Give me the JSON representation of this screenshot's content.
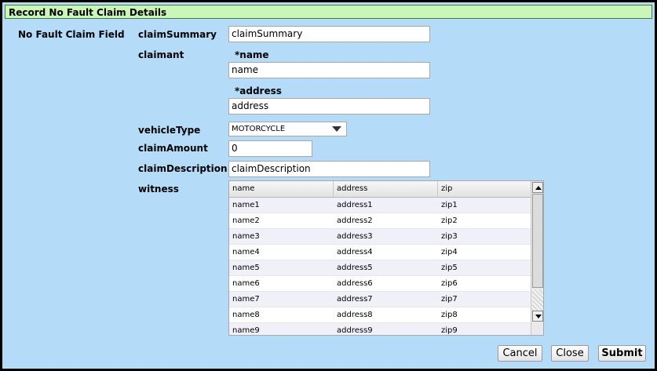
{
  "window": {
    "title": "Record No Fault Claim Details"
  },
  "form": {
    "section_label": "No Fault Claim Field",
    "claimSummary": {
      "label": "claimSummary",
      "value": "claimSummary"
    },
    "claimant": {
      "label": "claimant",
      "name": {
        "label": "name",
        "value": "name",
        "required_mark": "*"
      },
      "address": {
        "label": "address",
        "value": "address",
        "required_mark": "*"
      }
    },
    "vehicleType": {
      "label": "vehicleType",
      "value": "MOTORCYCLE"
    },
    "claimAmount": {
      "label": "claimAmount",
      "value": "0"
    },
    "claimDescription": {
      "label": "claimDescription",
      "value": "claimDescription"
    },
    "witness": {
      "label": "witness",
      "columns": [
        "name",
        "address",
        "zip"
      ],
      "rows": [
        [
          "name1",
          "address1",
          "zip1"
        ],
        [
          "name2",
          "address2",
          "zip2"
        ],
        [
          "name3",
          "address3",
          "zip3"
        ],
        [
          "name4",
          "address4",
          "zip4"
        ],
        [
          "name5",
          "address5",
          "zip5"
        ],
        [
          "name6",
          "address6",
          "zip6"
        ],
        [
          "name7",
          "address7",
          "zip7"
        ],
        [
          "name8",
          "address8",
          "zip8"
        ],
        [
          "name9",
          "address9",
          "zip9"
        ]
      ]
    }
  },
  "buttons": {
    "cancel": "Cancel",
    "close": "Close",
    "submit": "Submit"
  }
}
